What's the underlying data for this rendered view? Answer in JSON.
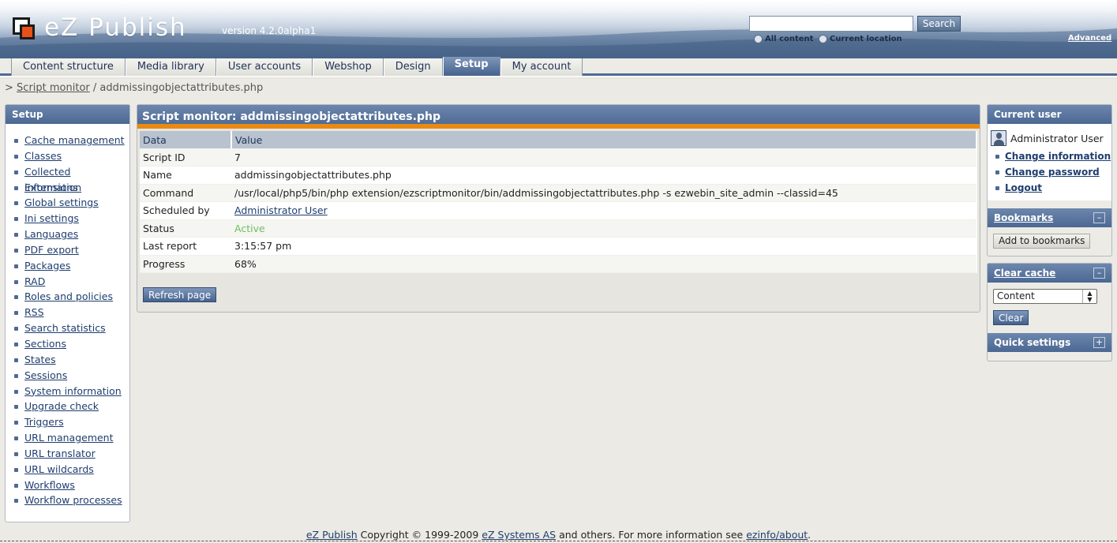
{
  "header": {
    "logo_text": "eZ Publish",
    "version": "version 4.2.0alpha1",
    "search_input_value": "",
    "search_button": "Search",
    "radio_all_content": "All content",
    "radio_current_location": "Current location",
    "advanced_link": "Advanced"
  },
  "tabs": [
    {
      "label": "Content structure",
      "active": false
    },
    {
      "label": "Media library",
      "active": false
    },
    {
      "label": "User accounts",
      "active": false
    },
    {
      "label": "Webshop",
      "active": false
    },
    {
      "label": "Design",
      "active": false
    },
    {
      "label": "Setup",
      "active": true
    },
    {
      "label": "My account",
      "active": false
    }
  ],
  "breadcrumb": {
    "prefix": ">",
    "link": "Script monitor",
    "separator": "/",
    "current": "addmissingobjectattributes.php"
  },
  "left_menu": {
    "title": "Setup",
    "items": [
      "Cache management",
      "Classes",
      "Collected information",
      "Extensions",
      "Global settings",
      "Ini settings",
      "Languages",
      "PDF export",
      "Packages",
      "RAD",
      "Roles and policies",
      "RSS",
      "Search statistics",
      "Sections",
      "States",
      "Sessions",
      "System information",
      "Upgrade check",
      "Triggers",
      "URL management",
      "URL translator",
      "URL wildcards",
      "Workflows",
      "Workflow processes"
    ]
  },
  "main": {
    "title": "Script monitor: addmissingobjectattributes.php",
    "table_headers": [
      "Data",
      "Value"
    ],
    "rows": [
      {
        "label": "Script ID",
        "value": "7"
      },
      {
        "label": "Name",
        "value": "addmissingobjectattributes.php"
      },
      {
        "label": "Command",
        "value": "/usr/local/php5/bin/php extension/ezscriptmonitor/bin/addmissingobjectattributes.php -s ezwebin_site_admin --classid=45"
      },
      {
        "label": "Scheduled by",
        "value": "Administrator User"
      },
      {
        "label": "Status",
        "value": "Active"
      },
      {
        "label": "Last report",
        "value": "3:15:57 pm"
      },
      {
        "label": "Progress",
        "value": "68%"
      }
    ],
    "refresh_button": "Refresh page"
  },
  "right": {
    "current_user_title": "Current user",
    "user_name": "Administrator User",
    "user_links": [
      "Change information",
      "Change password",
      "Logout"
    ],
    "bookmarks_title": "Bookmarks",
    "bookmarks_toggle": "–",
    "add_bookmarks_button": "Add to bookmarks",
    "clear_cache_title": "Clear cache",
    "clear_cache_toggle": "–",
    "cache_select_value": "Content",
    "clear_button": "Clear",
    "quick_settings_title": "Quick settings",
    "quick_settings_toggle": "+"
  },
  "footer": {
    "link1": "eZ Publish",
    "text1": "Copyright © 1999-2009",
    "link2": "eZ Systems AS",
    "text2": "and others. For more information see",
    "link3": "ezinfo/about",
    "text3": "."
  },
  "colors": {
    "accent_blue": "#4d6a93",
    "accent_orange": "#e98a12",
    "status_active": "#6cc063"
  }
}
